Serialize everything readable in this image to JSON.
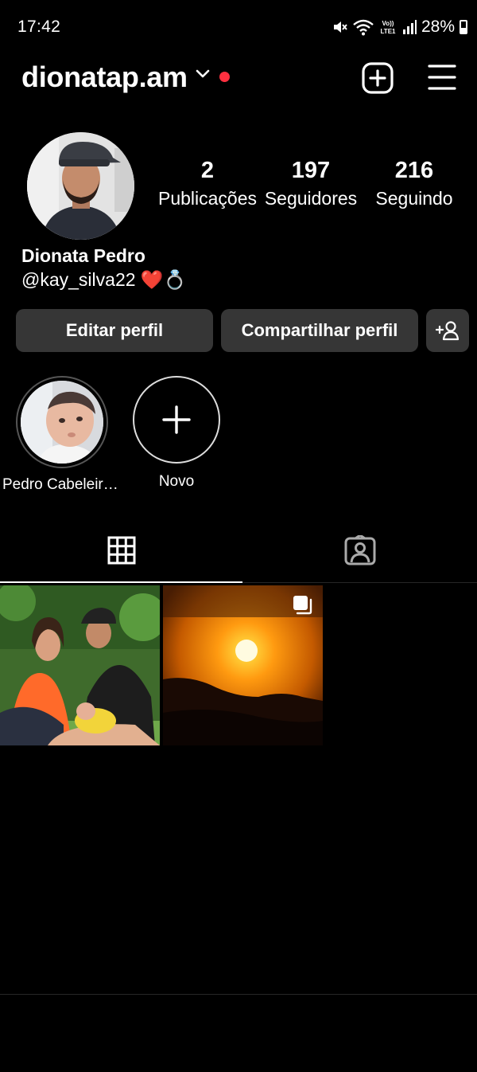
{
  "status_bar": {
    "time": "17:42",
    "battery_percent": "28%",
    "icons": [
      "mute-icon",
      "wifi-icon",
      "volte-icon",
      "signal-icon",
      "battery-icon"
    ]
  },
  "header": {
    "username": "dionatap.am",
    "has_notification_dot": true,
    "notification_color": "#ff3040"
  },
  "profile": {
    "stats": [
      {
        "count": "2",
        "label": "Publicações"
      },
      {
        "count": "197",
        "label": "Seguidores"
      },
      {
        "count": "216",
        "label": "Seguindo"
      }
    ],
    "display_name": "Dionata Pedro",
    "bio": "@kay_silva22 ❤️💍"
  },
  "actions": {
    "edit_label": "Editar perfil",
    "share_label": "Compartilhar perfil"
  },
  "highlights": [
    {
      "label": "Pedro Cabeleireiro"
    },
    {
      "label": "Novo"
    }
  ],
  "tabs": [
    {
      "name": "posts-grid",
      "icon": "grid-icon",
      "active": true
    },
    {
      "name": "tagged",
      "icon": "tagged-icon",
      "active": false
    }
  ],
  "posts": [
    {
      "type": "photo",
      "subject": "family photo in garden"
    },
    {
      "type": "carousel",
      "subject": "sunset over hills"
    }
  ],
  "colors": {
    "background": "#000000",
    "button": "#363636",
    "divider": "#262626"
  }
}
